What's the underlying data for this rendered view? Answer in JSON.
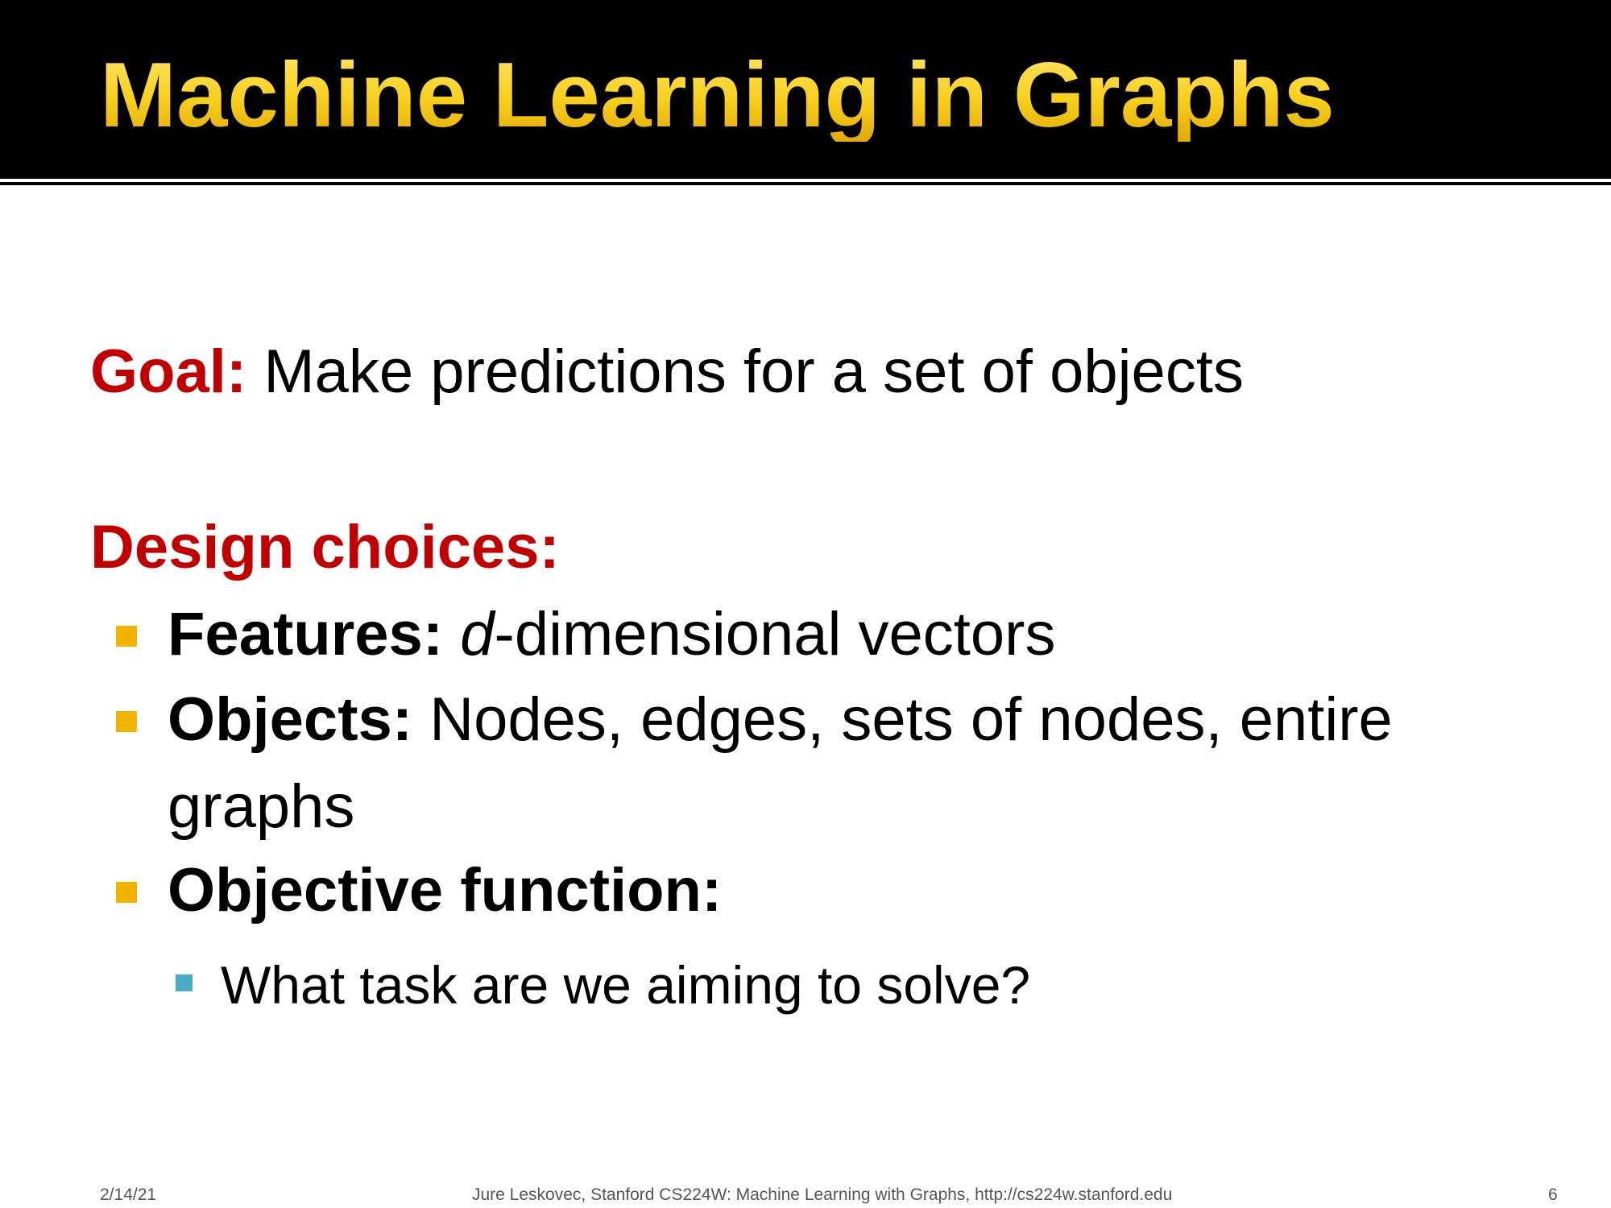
{
  "slide": {
    "title": "Machine Learning in Graphs",
    "goal_label": "Goal:",
    "goal_text": " Make predictions for a set of objects",
    "design_heading": "Design choices:",
    "bullets": [
      {
        "label": "Features:",
        "italic": "d",
        "text": "-dimensional vectors"
      },
      {
        "label": "Objects:",
        "text": " Nodes, edges, sets of nodes, entire",
        "continuation": "graphs"
      },
      {
        "label": "Objective function:"
      }
    ],
    "sub_bullet": "What task are we aiming to solve?",
    "colors": {
      "title": "#f7cf1c",
      "accent": "#c00000",
      "bullet": "#f0b400",
      "sub_bullet": "#4bacc6"
    }
  },
  "footer": {
    "date": "2/14/21",
    "center": "Jure Leskovec, Stanford CS224W: Machine Learning with Graphs, http://cs224w.stanford.edu",
    "page": "6"
  }
}
